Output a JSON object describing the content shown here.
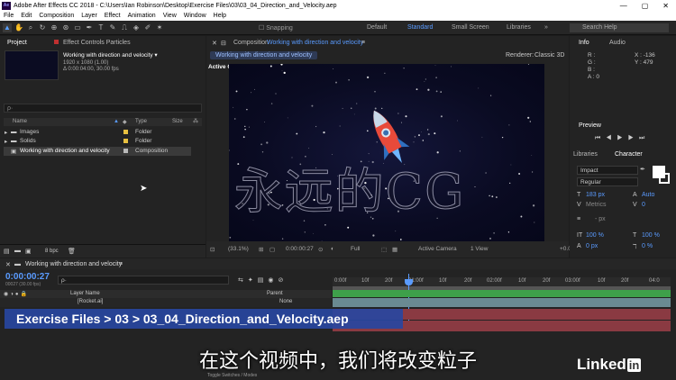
{
  "titlebar": {
    "title": "Adobe After Effects CC 2018 - C:\\Users\\Ian Robinson\\Desktop\\Exercise Files\\03\\03_04_Direction_and_Velocity.aep",
    "logo": "Ae",
    "min": "—",
    "max": "▢",
    "close": "✕"
  },
  "menubar": [
    "File",
    "Edit",
    "Composition",
    "Layer",
    "Effect",
    "Animation",
    "View",
    "Window",
    "Help"
  ],
  "toolbar": {
    "snapping": "Snapping",
    "workspaces": [
      "Default",
      "Standard",
      "Small Screen",
      "Libraries"
    ],
    "active_workspace": "Standard",
    "search_placeholder": "Search Help"
  },
  "project": {
    "tab_project": "Project",
    "tab_effects": "Effect Controls Particles",
    "comp_name": "Working with direction and velocity ▾",
    "comp_res": "1920 x 1080 (1.00)",
    "comp_dur": "Δ 0:00:04:00, 30.00 fps",
    "search_placeholder": "ρ·",
    "cols": {
      "name": "Name",
      "type": "Type",
      "size": "Size"
    },
    "rows": [
      {
        "name": "Images",
        "type": "Folder",
        "color": "#e8c040"
      },
      {
        "name": "Solids",
        "type": "Folder",
        "color": "#e8c040"
      },
      {
        "name": "Working with direction and velocity",
        "type": "Composition",
        "color": "#b9b9b9"
      }
    ],
    "bpc": "8 bpc"
  },
  "comp": {
    "tab_label": "Composition",
    "tab_name": "Working with direction and velocity",
    "breadcrumb": "Working with direction and velocity",
    "renderer_label": "Renderer:",
    "renderer": "Classic 3D",
    "active_camera": "Active Camera",
    "footer": {
      "zoom": "(33.1%)",
      "timecode": "0:00:00:27",
      "resolution": "Full",
      "camera": "Active Camera",
      "views": "1 View",
      "exposure": "+0.0"
    }
  },
  "info": {
    "tab_info": "Info",
    "tab_audio": "Audio",
    "labels": [
      "R :",
      "G :",
      "B :",
      "A : 0"
    ],
    "x": "X : -136",
    "y": "Y : 479"
  },
  "preview": {
    "title": "Preview"
  },
  "character": {
    "tab_libraries": "Libraries",
    "tab_character": "Character",
    "font": "Impact",
    "style": "Regular",
    "size": "183 px",
    "leading": "Auto",
    "kerning": "Metrics",
    "tracking": "0",
    "stroke": "- px",
    "vscale": "100 %",
    "hscale": "100 %",
    "baseline": "0 px",
    "tsume": "0 %"
  },
  "timeline": {
    "comp_name": "Working with direction and velocity",
    "timecode": "0:00:00:27",
    "subcode": "00027 (30.00 fps)",
    "col_layer": "Layer Name",
    "col_parent": "Parent",
    "layer_name": "[Rocket.ai]",
    "parent_val": "None",
    "ruler": [
      "0:00f",
      "10f",
      "20f",
      "01:00f",
      "10f",
      "20f",
      "02:00f",
      "10f",
      "20f",
      "03:00f",
      "10f",
      "20f",
      "04:0"
    ],
    "toggle": "Toggle Switches / Modes"
  },
  "overlay": {
    "breadcrumb": "Exercise Files > 03 > 03_04_Direction_and_Velocity.aep",
    "subtitle": "在这个视频中，我们将改变粒子",
    "watermark": "永远的CG",
    "brand": "Linked",
    "brand_in": "in"
  }
}
